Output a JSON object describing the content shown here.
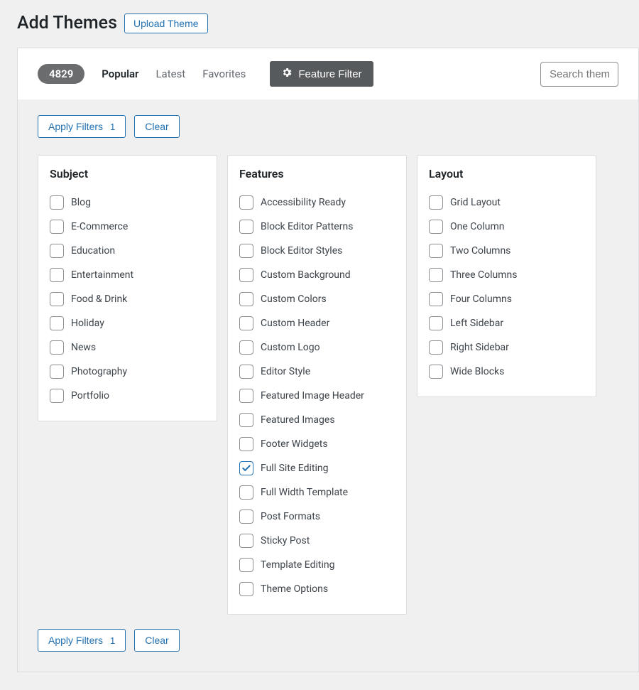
{
  "header": {
    "title": "Add Themes",
    "upload_label": "Upload Theme"
  },
  "browse": {
    "count": "4829",
    "tabs": [
      "Popular",
      "Latest",
      "Favorites"
    ],
    "feature_filter_label": "Feature Filter",
    "search_placeholder": "Search themes..."
  },
  "actions": {
    "apply_label": "Apply Filters",
    "apply_count": "1",
    "clear_label": "Clear"
  },
  "columns": {
    "subject": {
      "title": "Subject",
      "items": [
        {
          "label": "Blog",
          "checked": false
        },
        {
          "label": "E-Commerce",
          "checked": false
        },
        {
          "label": "Education",
          "checked": false
        },
        {
          "label": "Entertainment",
          "checked": false
        },
        {
          "label": "Food & Drink",
          "checked": false
        },
        {
          "label": "Holiday",
          "checked": false
        },
        {
          "label": "News",
          "checked": false
        },
        {
          "label": "Photography",
          "checked": false
        },
        {
          "label": "Portfolio",
          "checked": false
        }
      ]
    },
    "features": {
      "title": "Features",
      "items": [
        {
          "label": "Accessibility Ready",
          "checked": false
        },
        {
          "label": "Block Editor Patterns",
          "checked": false
        },
        {
          "label": "Block Editor Styles",
          "checked": false
        },
        {
          "label": "Custom Background",
          "checked": false
        },
        {
          "label": "Custom Colors",
          "checked": false
        },
        {
          "label": "Custom Header",
          "checked": false
        },
        {
          "label": "Custom Logo",
          "checked": false
        },
        {
          "label": "Editor Style",
          "checked": false
        },
        {
          "label": "Featured Image Header",
          "checked": false
        },
        {
          "label": "Featured Images",
          "checked": false
        },
        {
          "label": "Footer Widgets",
          "checked": false
        },
        {
          "label": "Full Site Editing",
          "checked": true
        },
        {
          "label": "Full Width Template",
          "checked": false
        },
        {
          "label": "Post Formats",
          "checked": false
        },
        {
          "label": "Sticky Post",
          "checked": false
        },
        {
          "label": "Template Editing",
          "checked": false
        },
        {
          "label": "Theme Options",
          "checked": false
        }
      ]
    },
    "layout": {
      "title": "Layout",
      "items": [
        {
          "label": "Grid Layout",
          "checked": false
        },
        {
          "label": "One Column",
          "checked": false
        },
        {
          "label": "Two Columns",
          "checked": false
        },
        {
          "label": "Three Columns",
          "checked": false
        },
        {
          "label": "Four Columns",
          "checked": false
        },
        {
          "label": "Left Sidebar",
          "checked": false
        },
        {
          "label": "Right Sidebar",
          "checked": false
        },
        {
          "label": "Wide Blocks",
          "checked": false
        }
      ]
    }
  }
}
